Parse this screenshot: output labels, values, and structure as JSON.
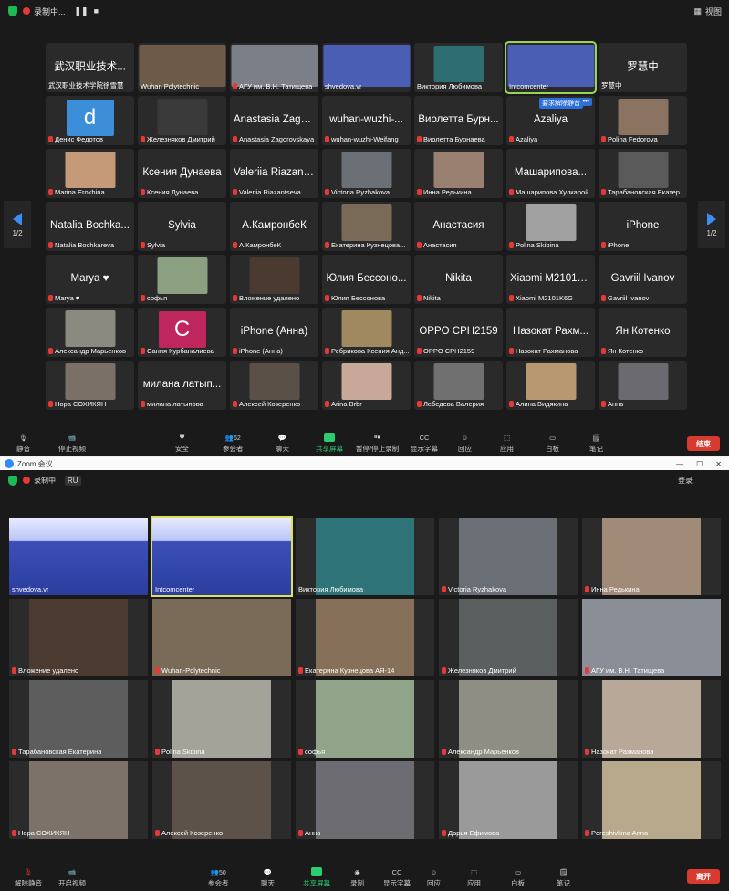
{
  "window1": {
    "recording_label": "录制中...",
    "view_label": "视图",
    "page_indicator": "1/2",
    "tiles": [
      {
        "name": "武汉职业技术...",
        "label": "武汉职业技术学院徐雪慧",
        "kind": "text"
      },
      {
        "name": "",
        "label": "Wuhan Polytechnic",
        "kind": "video",
        "color": "#6d5a48"
      },
      {
        "name": "",
        "label": "АГУ им. В.Н. Татищева",
        "kind": "video",
        "color": "#7a7f88"
      },
      {
        "name": "",
        "label": "shvedova.vr",
        "kind": "video",
        "color": "#4a5fb4"
      },
      {
        "name": "",
        "label": "Виктория Любимова",
        "kind": "video",
        "color": "#2f6e70"
      },
      {
        "name": "",
        "label": "Intcomcenter",
        "kind": "video",
        "color": "#4a5fb4",
        "highlight": true
      },
      {
        "name": "罗慧中",
        "label": "罗慧中",
        "kind": "text"
      },
      {
        "name": "d",
        "label": "Денис Федотов",
        "kind": "avatar",
        "color": "#3d8ed8"
      },
      {
        "name": "",
        "label": "Железняков Дмитрий",
        "kind": "video",
        "color": "#3a3a3a"
      },
      {
        "name": "Anastasia Zago...",
        "label": "Anastasia Zagorovskaya",
        "kind": "text"
      },
      {
        "name": "wuhan-wuzhi-...",
        "label": "wuhan-wuzhi-Weifang",
        "kind": "text"
      },
      {
        "name": "Виолетта Бурн...",
        "label": "Виолетта Бурнаева",
        "kind": "text"
      },
      {
        "name": "Azaliya",
        "label": "Azaliya",
        "kind": "text",
        "banner": "要求解除静音"
      },
      {
        "name": "",
        "label": "Polina Fedorova",
        "kind": "video",
        "color": "#8a7360"
      },
      {
        "name": "",
        "label": "Marina Erokhina",
        "kind": "video",
        "color": "#c49a78"
      },
      {
        "name": "Ксения Дунаева",
        "label": "Ксения Дунаева",
        "kind": "text"
      },
      {
        "name": "Valeriia Riazant...",
        "label": "Valeriia Riazantseva",
        "kind": "text"
      },
      {
        "name": "",
        "label": "Victoria Ryzhakova",
        "kind": "video",
        "color": "#6b7076"
      },
      {
        "name": "",
        "label": "Инна Редькина",
        "kind": "video",
        "color": "#9a8070"
      },
      {
        "name": "Машарипова...",
        "label": "Машарипова Хулкарой",
        "kind": "text"
      },
      {
        "name": "",
        "label": "Тарабановская Екатер...",
        "kind": "video",
        "color": "#5a5a5a"
      },
      {
        "name": "Natalia Bochka...",
        "label": "Natalia Bochkareva",
        "kind": "text"
      },
      {
        "name": "Sylvia",
        "label": "Sylvia",
        "kind": "text"
      },
      {
        "name": "А.КамронбеК",
        "label": "А.КамронбеК",
        "kind": "text"
      },
      {
        "name": "",
        "label": "Екатерина Кузнецова...",
        "kind": "video",
        "color": "#7a6a58"
      },
      {
        "name": "Анастасия",
        "label": "Анастасия",
        "kind": "text"
      },
      {
        "name": "",
        "label": "Polina Skibina",
        "kind": "video",
        "color": "#a0a0a0"
      },
      {
        "name": "iPhone",
        "label": "iPhone",
        "kind": "text"
      },
      {
        "name": "Marya ♥",
        "label": "Marya ♥",
        "kind": "text"
      },
      {
        "name": "",
        "label": "софья",
        "kind": "video",
        "color": "#8aa080"
      },
      {
        "name": "",
        "label": "Вложение удалено",
        "kind": "video",
        "color": "#4a3a30"
      },
      {
        "name": "Юлия Бессоно...",
        "label": "Юлия Бессонова",
        "kind": "text"
      },
      {
        "name": "Nikita",
        "label": "Nikita",
        "kind": "text"
      },
      {
        "name": "Xiaomi M2101K...",
        "label": "Xiaomi M2101K6G",
        "kind": "text"
      },
      {
        "name": "Gavriil Ivanov",
        "label": "Gavriil Ivanov",
        "kind": "text"
      },
      {
        "name": "",
        "label": "Александр Марьенков",
        "kind": "video",
        "color": "#8a8a80"
      },
      {
        "name": "С",
        "label": "Сания Курбаналиева",
        "kind": "avatar",
        "color": "#c0265e"
      },
      {
        "name": "iPhone (Анна)",
        "label": "iPhone (Анна)",
        "kind": "text"
      },
      {
        "name": "",
        "label": "Ребрикова Ксения Анд...",
        "kind": "video",
        "color": "#a08860"
      },
      {
        "name": "OPPO CPH2159",
        "label": "OPPO CPH2159",
        "kind": "text"
      },
      {
        "name": "Назокат Рахм...",
        "label": "Назокат Рахманова",
        "kind": "text"
      },
      {
        "name": "Ян Котенко",
        "label": "Ян Котенко",
        "kind": "text"
      },
      {
        "name": "",
        "label": "Нора СОХИКЯН",
        "kind": "video",
        "color": "#7a7068"
      },
      {
        "name": "милана латып...",
        "label": "милана латыпова",
        "kind": "text"
      },
      {
        "name": "",
        "label": "Алексей Козеренко",
        "kind": "video",
        "color": "#5a5048"
      },
      {
        "name": "",
        "label": "Arina Brbr",
        "kind": "video",
        "color": "#c8a898"
      },
      {
        "name": "",
        "label": "Лебедева Валерия",
        "kind": "video",
        "color": "#707070"
      },
      {
        "name": "",
        "label": "Алина Видякина",
        "kind": "video",
        "color": "#b89870"
      },
      {
        "name": "",
        "label": "Анна",
        "kind": "video",
        "color": "#6a6a70"
      }
    ],
    "toolbar": {
      "mute": "静音",
      "stop_video": "停止视频",
      "security": "安全",
      "participants": "参会者",
      "participants_count": "62",
      "chat": "聊天",
      "share": "共享屏幕",
      "pause_record": "暂停/停止录制",
      "captions": "显示字幕",
      "reactions": "回应",
      "apps": "应用",
      "whiteboard": "白板",
      "notes": "笔记",
      "end": "结束"
    }
  },
  "window2": {
    "title": "Zoom 会议",
    "recording_label": "录制中",
    "lang": "RU",
    "login": "登录",
    "tiles": [
      {
        "label": "shvedova.vr",
        "kind": "poster"
      },
      {
        "label": "Intcomcenter",
        "kind": "poster",
        "highlight": true
      },
      {
        "label": "Виктория Любимова",
        "color": "#2e7478"
      },
      {
        "label": "Victoria Ryzhakova",
        "color": "#6a6f75"
      },
      {
        "label": "Инна Редькина",
        "color": "#a08a78"
      },
      {
        "label": "Вложение удалено",
        "color": "#4b3b31"
      },
      {
        "label": "Wuhan-Polytechnic",
        "color": "#7a6a58",
        "full": true
      },
      {
        "label": "Екатерина Кузнецова АЯ-14",
        "color": "#86705a"
      },
      {
        "label": "Железняков Дмитрий",
        "color": "#5a5f60"
      },
      {
        "label": "АГУ им. В.Н. Татищева",
        "color": "#8a8e96",
        "full": true
      },
      {
        "label": "Тарабановская Екатерина",
        "color": "#5d5d5d"
      },
      {
        "label": "Polina Skibina",
        "color": "#a4a39a"
      },
      {
        "label": "софья",
        "color": "#8fa488"
      },
      {
        "label": "Александр Марьенков",
        "color": "#8e8e84"
      },
      {
        "label": "Назокат Рахманова",
        "color": "#b8a898"
      },
      {
        "label": "Нора СОХИКЯН",
        "color": "#7c726a"
      },
      {
        "label": "Алексей Козеренко",
        "color": "#5c524a"
      },
      {
        "label": "Анна",
        "color": "#6c6c72"
      },
      {
        "label": "Дарья Ефимова",
        "color": "#9a9a9a"
      },
      {
        "label": "Pereshivkina Arina",
        "color": "#b8a88c"
      }
    ],
    "toolbar": {
      "unmute": "解除静音",
      "start_video": "开启视频",
      "participants": "参会者",
      "participants_count": "50",
      "chat": "聊天",
      "share": "共享屏幕",
      "record": "录制",
      "captions": "显示字幕",
      "reactions": "回应",
      "apps": "应用",
      "whiteboard": "白板",
      "notes": "笔记",
      "leave": "离开"
    }
  }
}
